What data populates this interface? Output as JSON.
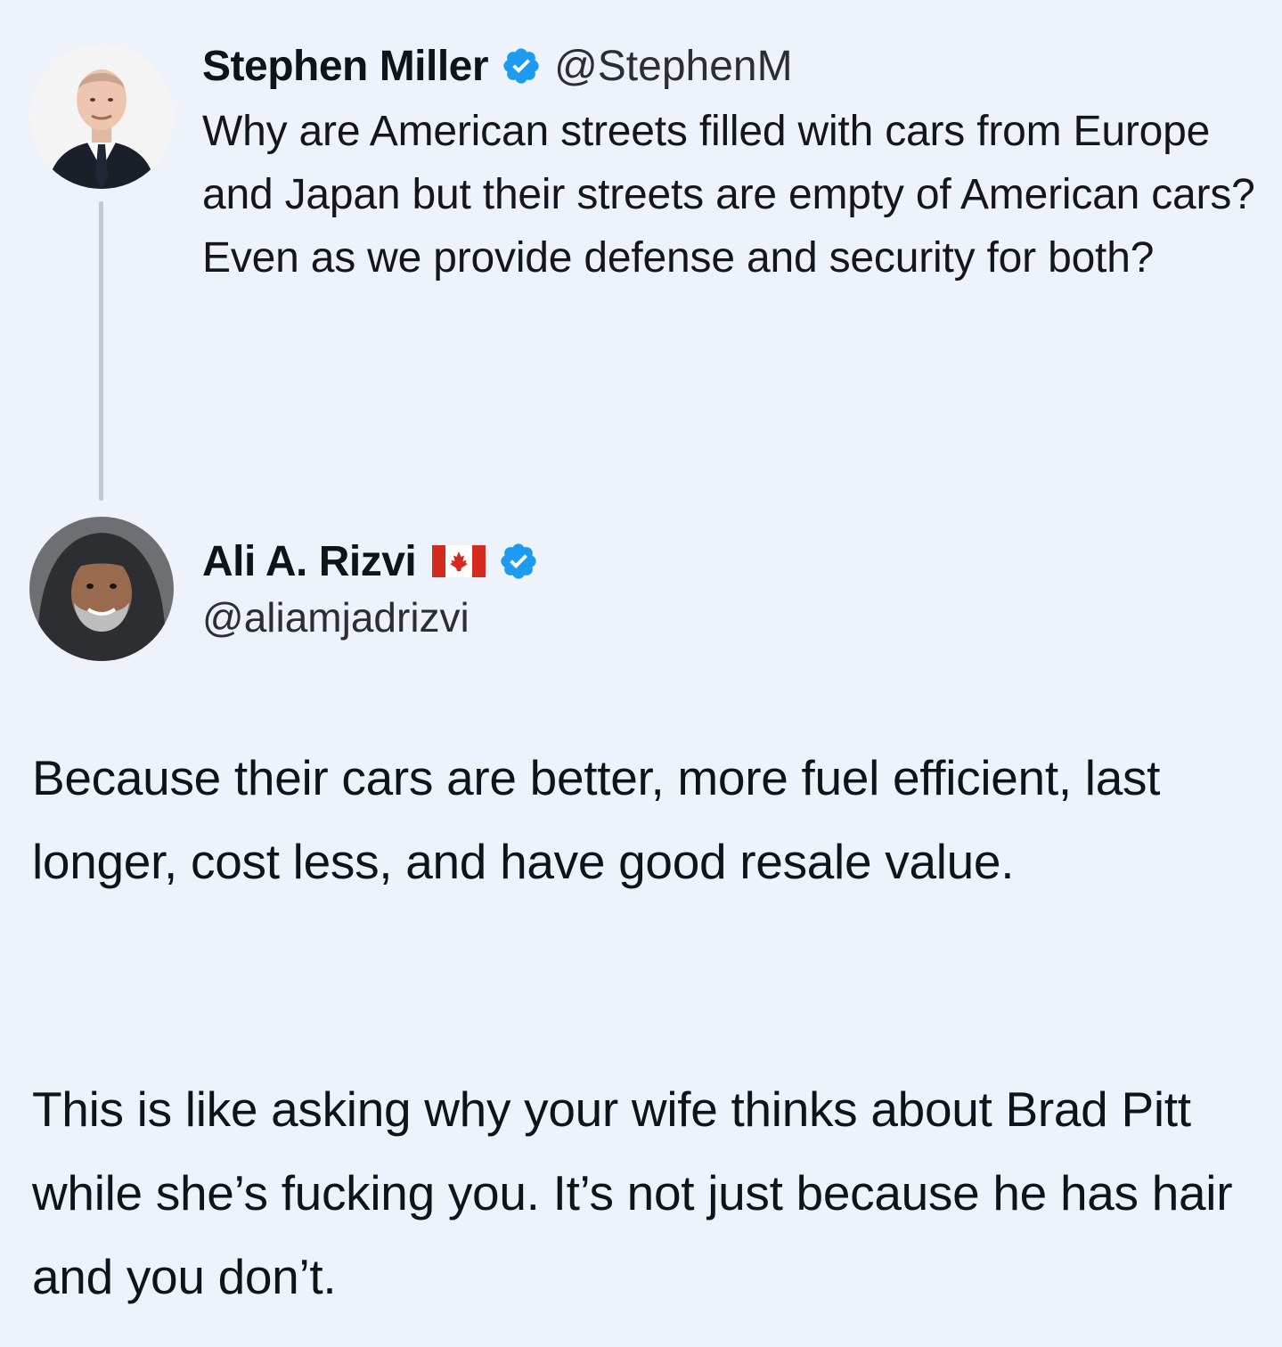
{
  "colors": {
    "background": "#eef2fb",
    "verified": "#1d9bf0",
    "thread_line": "#c3c9d3",
    "canada_red": "#d52b1e"
  },
  "original_tweet": {
    "author": {
      "display_name": "Stephen Miller",
      "handle": "@StephenM",
      "verified": true,
      "avatar_icon": "avatar-photo-man-in-suit"
    },
    "text": "Why are American streets filled with cars from Europe and Japan but their streets are empty of American cars? Even as we provide defense and security for both?"
  },
  "reply_tweet": {
    "author": {
      "display_name": "Ali A. Rizvi",
      "flag_icon": "canada-flag-icon",
      "handle": "@aliamjadrizvi",
      "verified": true,
      "avatar_icon": "avatar-photo-man-in-hood"
    },
    "paragraphs": [
      "Because their cars are better, more fuel efficient, last longer, cost less, and have good resale value.",
      "This is like asking why your wife thinks about Brad Pitt while she’s fucking you. It’s not just because he has hair and you don’t."
    ]
  }
}
